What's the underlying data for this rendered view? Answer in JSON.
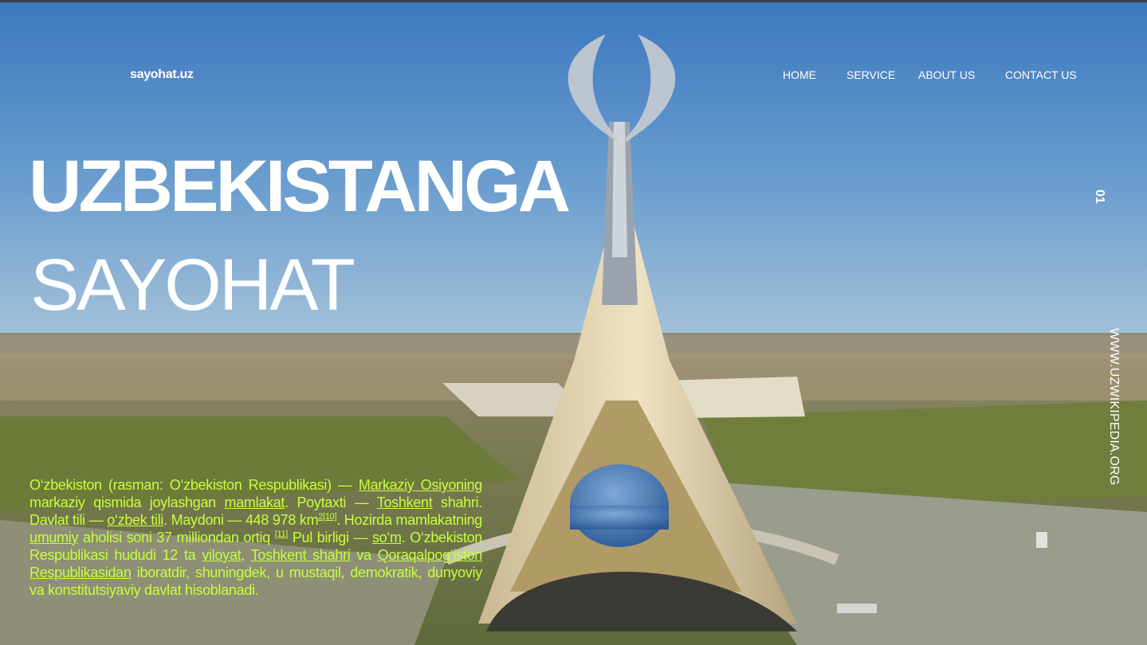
{
  "header": {
    "logo": "sayohat.uz",
    "nav": [
      "HOME",
      "SERVICE",
      "ABOUT US",
      "CONTACT US"
    ]
  },
  "hero": {
    "title_line1": "UZBEKISTANGA",
    "title_line2": "SAYOHAT"
  },
  "side": {
    "slide_number": "01",
    "source": "WWW.UZWIKIPEDIA.ORG"
  },
  "description": {
    "p1": "O‘zbekiston (rasman: O‘zbekiston Respublikasi) — ",
    "l1": "Markaziy Osiyoning",
    "p2": " markaziy qismida joylashgan ",
    "l2": "mamlakat",
    "p3": ". Poytaxti — ",
    "l3": "Toshkent",
    "p4": " shahri. Davlat tili — ",
    "l4": "o‘zbek tili",
    "p5": ". Maydoni — 448 978 km",
    "s1": "2[10]",
    "p6": ". Hozirda mamlakatning ",
    "l5": "umumiy",
    "p7": " aholisi soni 37 milliondan ortiq ",
    "s2": "[11]",
    "p8": " Pul birligi — ",
    "l6": "so‘m",
    "p9": ". O‘zbekiston Respublikasi hududi 12 ta ",
    "l7": "viloyat",
    "p10": ", ",
    "l8": "Toshkent shahri",
    "p11": " va ",
    "l9": "Qoraqalpog‘iston Respublikasidan",
    "p12": " iboratdir, shuningdek, u mustaqil, demokratik, dunyoviy va konstitutsiyaviy davlat hisoblanadi."
  },
  "colors": {
    "accent_text": "#c6ff3c",
    "sky": "#4a7fb8",
    "topbar": "#3a3f46"
  },
  "icons": [
    "monument-photo"
  ]
}
